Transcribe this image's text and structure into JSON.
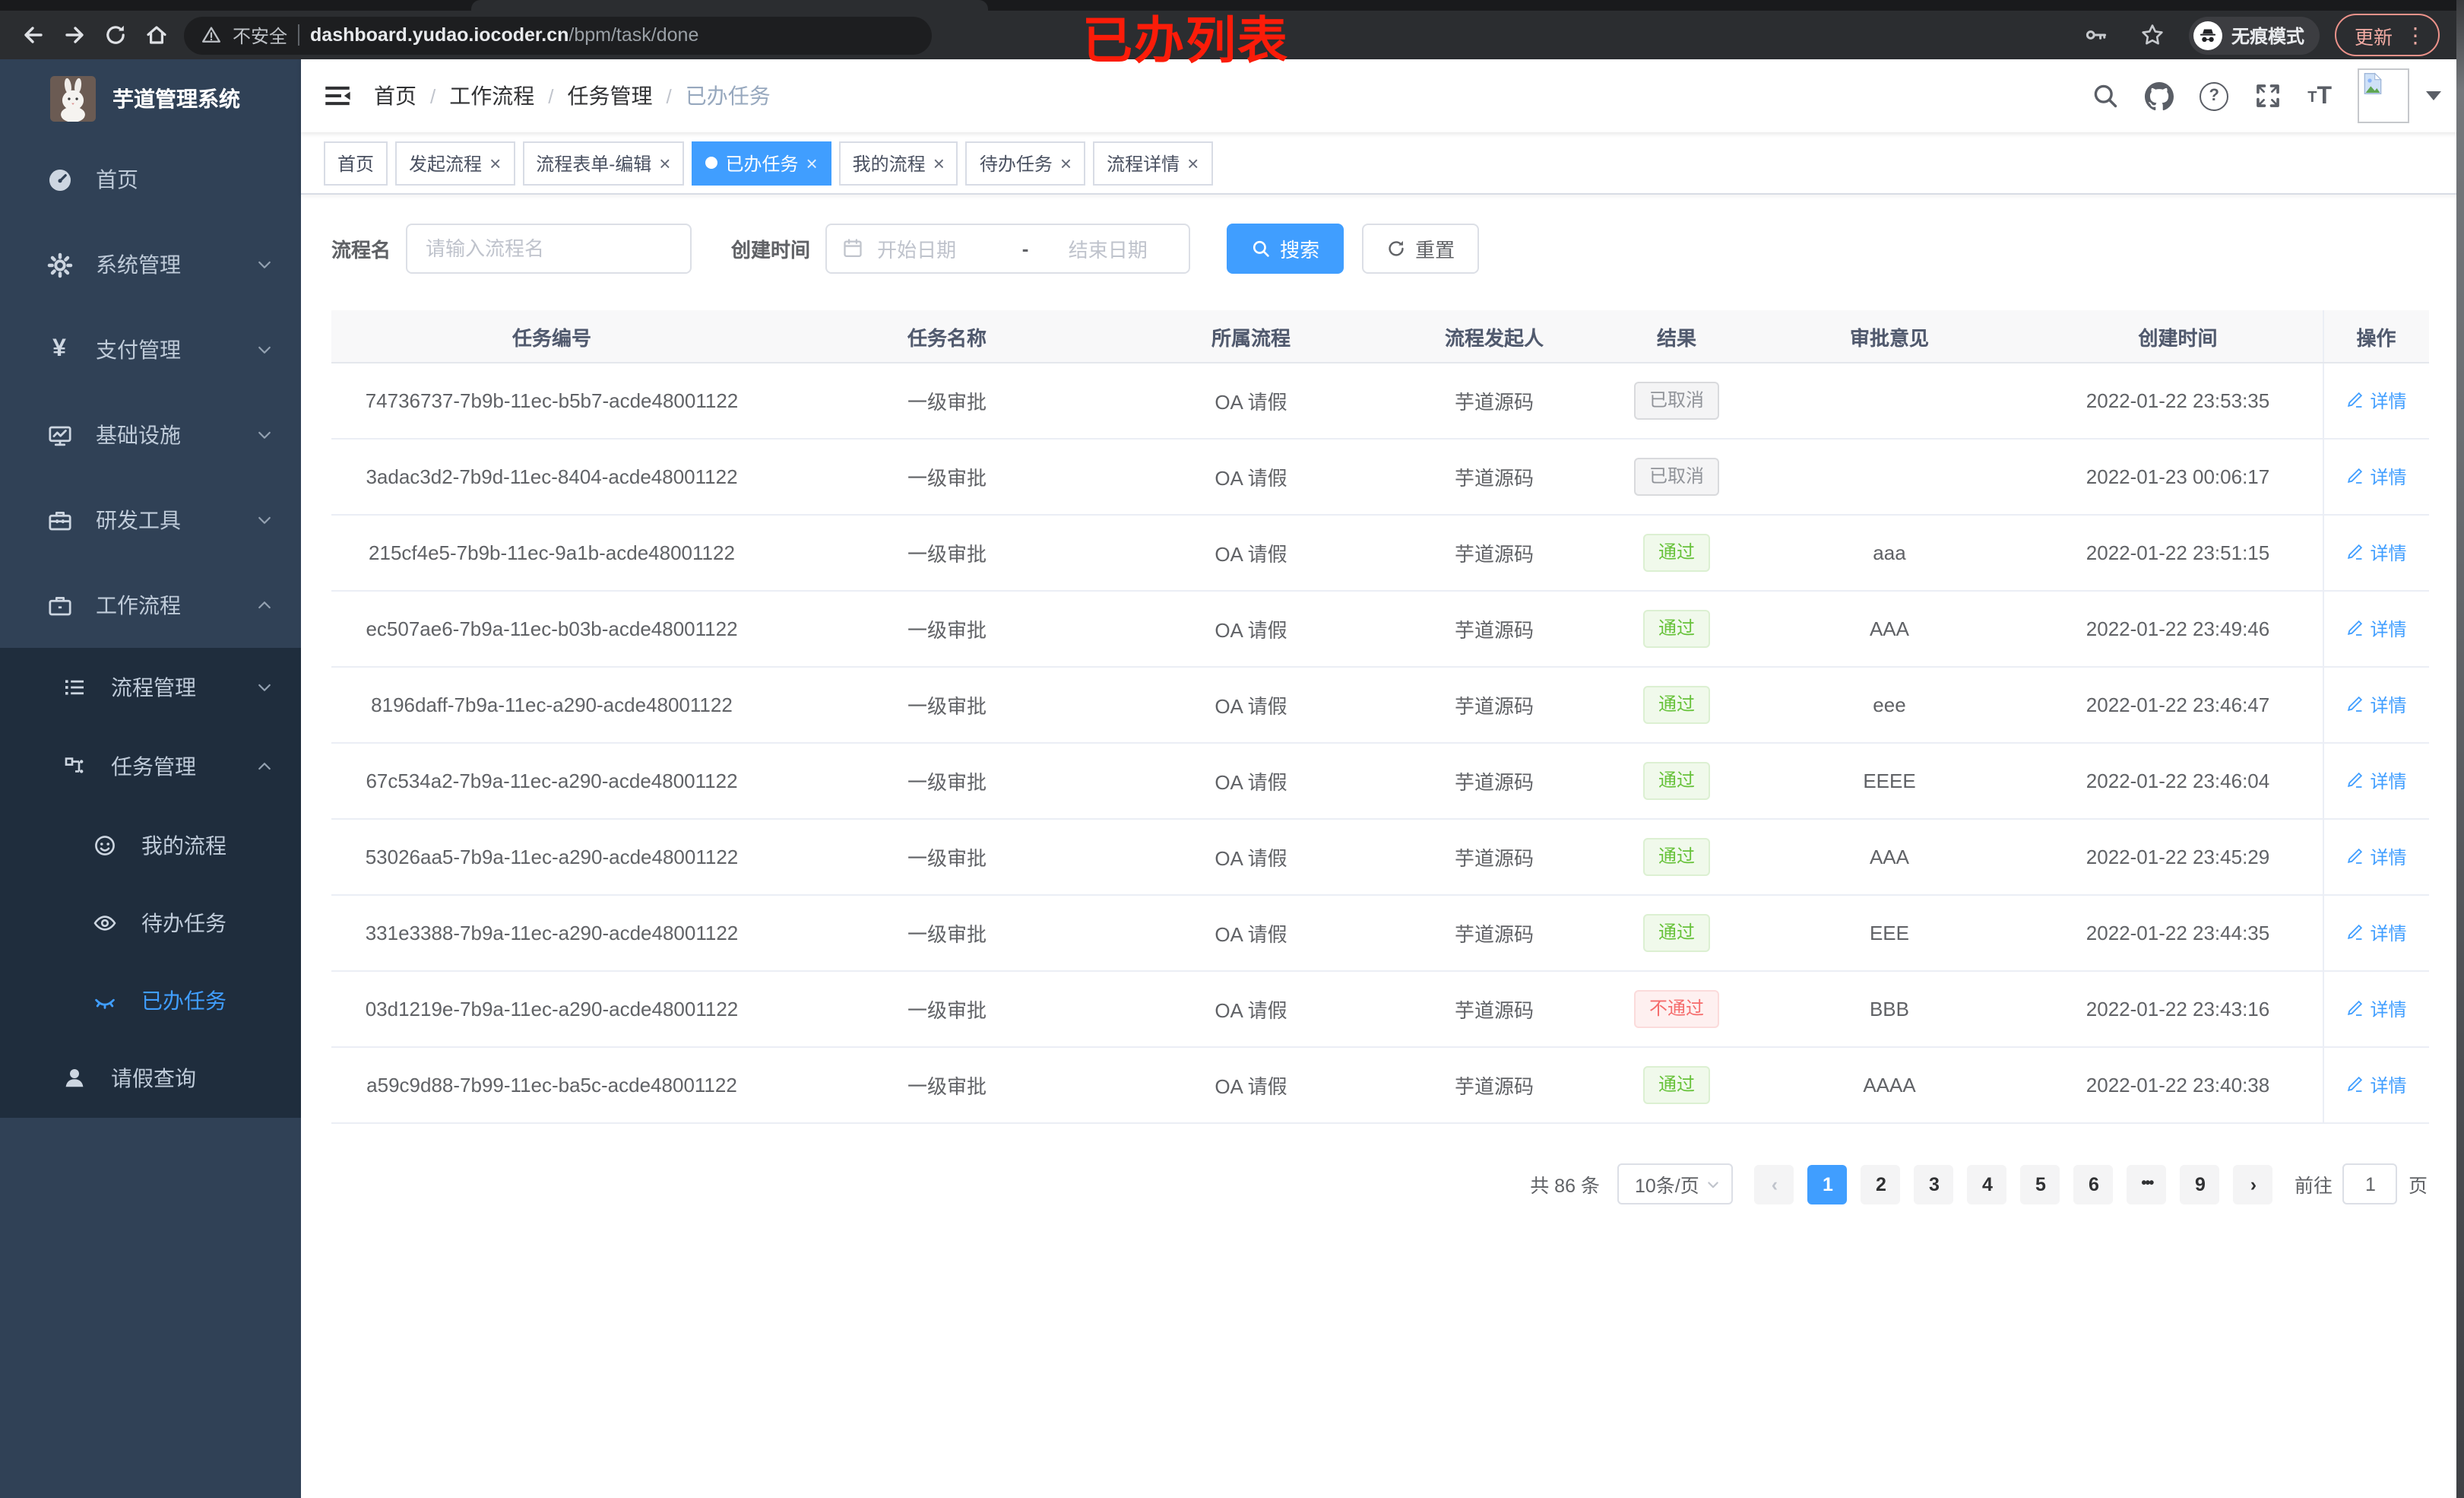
{
  "browser": {
    "security_label": "不安全",
    "url_host": "dashboard.yudao.iocoder.cn",
    "url_path": "/bpm/task/done",
    "incognito_label": "无痕模式",
    "update_label": "更新",
    "menu_glyph": "⋮"
  },
  "annotation": "已办列表",
  "sidebar": {
    "title": "芋道管理系统",
    "items": [
      {
        "label": "首页"
      },
      {
        "label": "系统管理"
      },
      {
        "label": "支付管理"
      },
      {
        "label": "基础设施"
      },
      {
        "label": "研发工具"
      },
      {
        "label": "工作流程"
      }
    ],
    "workflow_menu": [
      {
        "label": "流程管理"
      },
      {
        "label": "任务管理"
      },
      {
        "label": "我的流程"
      },
      {
        "label": "待办任务"
      },
      {
        "label": "已办任务"
      },
      {
        "label": "请假查询"
      }
    ]
  },
  "icons": {
    "yen": "¥"
  },
  "navbar": {
    "breadcrumb": [
      "首页",
      "工作流程",
      "任务管理",
      "已办任务"
    ],
    "separator": "/",
    "help_glyph": "?",
    "font_small": "T",
    "font_large": "T"
  },
  "tabs": {
    "close_glyph": "×",
    "items": [
      {
        "label": "首页"
      },
      {
        "label": "发起流程"
      },
      {
        "label": "流程表单-编辑"
      },
      {
        "label": "已办任务"
      },
      {
        "label": "我的流程"
      },
      {
        "label": "待办任务"
      },
      {
        "label": "流程详情"
      }
    ]
  },
  "search": {
    "name_label": "流程名",
    "name_placeholder": "请输入流程名",
    "time_label": "创建时间",
    "start_placeholder": "开始日期",
    "range_separator": "-",
    "end_placeholder": "结束日期",
    "search_label": "搜索",
    "reset_label": "重置"
  },
  "table": {
    "headers": [
      "任务编号",
      "任务名称",
      "所属流程",
      "流程发起人",
      "结果",
      "审批意见",
      "创建时间",
      "操作"
    ],
    "action_label": "详情",
    "rows": [
      {
        "id": "74736737-7b9b-11ec-b5b7-acde48001122",
        "name": "一级审批",
        "process": "OA 请假",
        "starter": "芋道源码",
        "result": "已取消",
        "result_type": "info",
        "comment": "",
        "created": "2022-01-22 23:53:35"
      },
      {
        "id": "3adac3d2-7b9d-11ec-8404-acde48001122",
        "name": "一级审批",
        "process": "OA 请假",
        "starter": "芋道源码",
        "result": "已取消",
        "result_type": "info",
        "comment": "",
        "created": "2022-01-23 00:06:17"
      },
      {
        "id": "215cf4e5-7b9b-11ec-9a1b-acde48001122",
        "name": "一级审批",
        "process": "OA 请假",
        "starter": "芋道源码",
        "result": "通过",
        "result_type": "success",
        "comment": "aaa",
        "created": "2022-01-22 23:51:15"
      },
      {
        "id": "ec507ae6-7b9a-11ec-b03b-acde48001122",
        "name": "一级审批",
        "process": "OA 请假",
        "starter": "芋道源码",
        "result": "通过",
        "result_type": "success",
        "comment": "AAA",
        "created": "2022-01-22 23:49:46"
      },
      {
        "id": "8196daff-7b9a-11ec-a290-acde48001122",
        "name": "一级审批",
        "process": "OA 请假",
        "starter": "芋道源码",
        "result": "通过",
        "result_type": "success",
        "comment": "eee",
        "created": "2022-01-22 23:46:47"
      },
      {
        "id": "67c534a2-7b9a-11ec-a290-acde48001122",
        "name": "一级审批",
        "process": "OA 请假",
        "starter": "芋道源码",
        "result": "通过",
        "result_type": "success",
        "comment": "EEEE",
        "created": "2022-01-22 23:46:04"
      },
      {
        "id": "53026aa5-7b9a-11ec-a290-acde48001122",
        "name": "一级审批",
        "process": "OA 请假",
        "starter": "芋道源码",
        "result": "通过",
        "result_type": "success",
        "comment": "AAA",
        "created": "2022-01-22 23:45:29"
      },
      {
        "id": "331e3388-7b9a-11ec-a290-acde48001122",
        "name": "一级审批",
        "process": "OA 请假",
        "starter": "芋道源码",
        "result": "通过",
        "result_type": "success",
        "comment": "EEE",
        "created": "2022-01-22 23:44:35"
      },
      {
        "id": "03d1219e-7b9a-11ec-a290-acde48001122",
        "name": "一级审批",
        "process": "OA 请假",
        "starter": "芋道源码",
        "result": "不通过",
        "result_type": "danger",
        "comment": "BBB",
        "created": "2022-01-22 23:43:16"
      },
      {
        "id": "a59c9d88-7b99-11ec-ba5c-acde48001122",
        "name": "一级审批",
        "process": "OA 请假",
        "starter": "芋道源码",
        "result": "通过",
        "result_type": "success",
        "comment": "AAAA",
        "created": "2022-01-22 23:40:38"
      }
    ]
  },
  "pagination": {
    "total": "共 86 条",
    "page_size": "10条/页",
    "prev_glyph": "‹",
    "next_glyph": "›",
    "pages": [
      "1",
      "2",
      "3",
      "4",
      "5",
      "6",
      "•••",
      "9"
    ],
    "goto_label": "前往",
    "goto_value": "1",
    "goto_unit": "页"
  }
}
